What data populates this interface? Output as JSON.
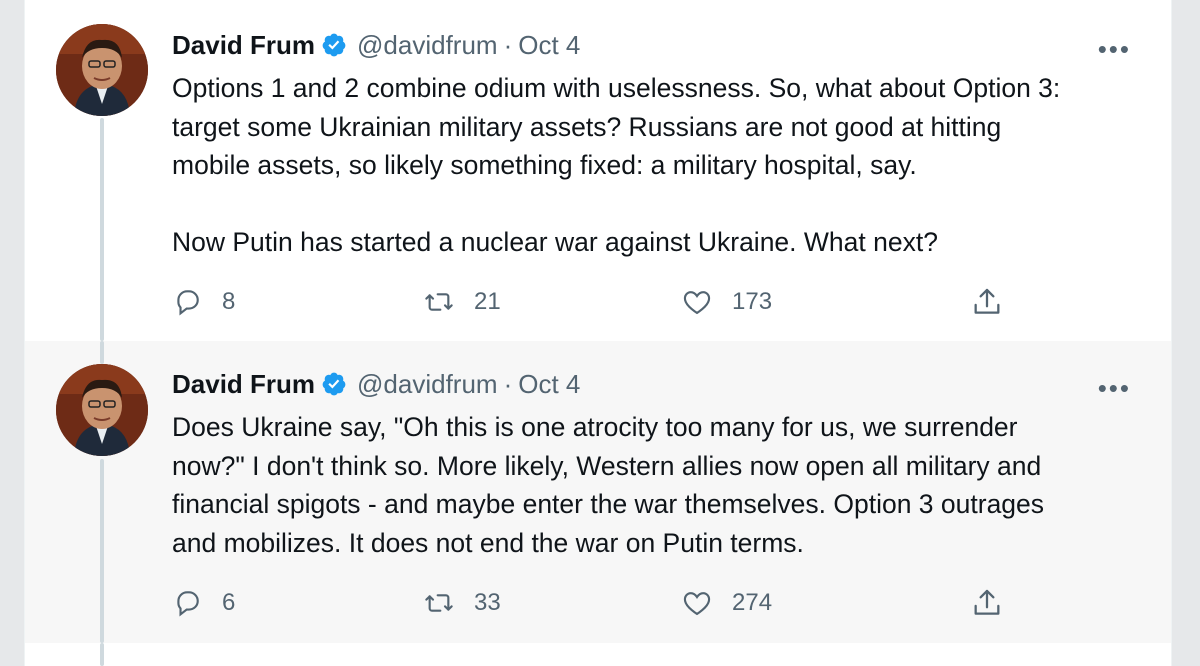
{
  "tweets": [
    {
      "author_name": "David Frum",
      "handle": "@davidfrum",
      "separator": "·",
      "date": "Oct 4",
      "more_label": "•••",
      "lines": [
        "Options 1 and 2 combine odium with uselessness. So, what about Option 3:",
        "target some Ukrainian military assets? Russians are not good at hitting",
        "mobile assets, so likely something fixed: a military hospital, say.",
        "",
        "Now Putin has started a nuclear war against Ukraine. What next?"
      ],
      "replies": "8",
      "retweets": "21",
      "likes": "173",
      "avatar_icon": "profile-photo",
      "verified_icon": "verified-badge"
    },
    {
      "author_name": "David Frum",
      "handle": "@davidfrum",
      "separator": "·",
      "date": "Oct 4",
      "more_label": "•••",
      "lines": [
        "Does Ukraine say, \"Oh this is one atrocity too many for us, we surrender",
        "now?\" I don't think so. More likely, Western allies now open all military and",
        "financial spigots - and maybe enter the war themselves. Option 3 outrages",
        "and mobilizes. It does not end the war on Putin terms."
      ],
      "replies": "6",
      "retweets": "33",
      "likes": "274",
      "avatar_icon": "profile-photo",
      "verified_icon": "verified-badge"
    }
  ],
  "colors": {
    "verified": "#1d9bf0",
    "text": "#0f1419",
    "secondary": "#536471",
    "thread_line": "#cfd9de"
  }
}
